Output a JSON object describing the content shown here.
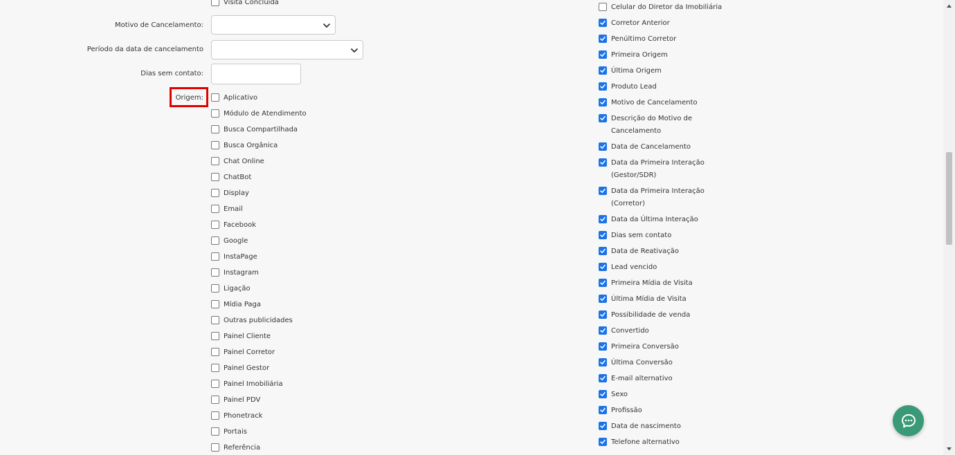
{
  "filters": {
    "top_partial_item": "Visita Concluída",
    "cancel_reason_label": "Motivo de Cancelamento:",
    "cancel_period_label": "Período da data de cancelamento",
    "days_no_contact_label": "Dias sem contato:",
    "origin_label": "Origem:",
    "origin_options": [
      "Aplicativo",
      "Módulo de Atendimento",
      "Busca Compartilhada",
      "Busca Orgânica",
      "Chat Online",
      "ChatBot",
      "Display",
      "Email",
      "Facebook",
      "Google",
      "InstaPage",
      "Instagram",
      "Ligação",
      "Mídia Paga",
      "Outras publicidades",
      "Painel Cliente",
      "Painel Corretor",
      "Painel Gestor",
      "Painel Imobiliária",
      "Painel PDV",
      "Phonetrack",
      "Portais",
      "Referência"
    ]
  },
  "columns": {
    "items": [
      {
        "label": "Celular do Diretor da Imobiliária",
        "checked": false
      },
      {
        "label": "Corretor Anterior",
        "checked": true
      },
      {
        "label": "Penúltimo Corretor",
        "checked": true
      },
      {
        "label": "Primeira Origem",
        "checked": true
      },
      {
        "label": "Última Origem",
        "checked": true
      },
      {
        "label": "Produto Lead",
        "checked": true
      },
      {
        "label": "Motivo de Cancelamento",
        "checked": true
      },
      {
        "label": "Descrição do Motivo de Cancelamento",
        "checked": true
      },
      {
        "label": "Data de Cancelamento",
        "checked": true
      },
      {
        "label": "Data da Primeira Interação (Gestor/SDR)",
        "checked": true
      },
      {
        "label": "Data da Primeira Interação (Corretor)",
        "checked": true
      },
      {
        "label": "Data da Última Interação",
        "checked": true
      },
      {
        "label": "Dias sem contato",
        "checked": true
      },
      {
        "label": "Data de Reativação",
        "checked": true
      },
      {
        "label": "Lead vencido",
        "checked": true
      },
      {
        "label": "Primeira Mídia de Visita",
        "checked": true
      },
      {
        "label": "Última Mídia de Visita",
        "checked": true
      },
      {
        "label": "Possibilidade de venda",
        "checked": true
      },
      {
        "label": "Convertido",
        "checked": true
      },
      {
        "label": "Primeira Conversão",
        "checked": true
      },
      {
        "label": "Última Conversão",
        "checked": true
      },
      {
        "label": "E-mail alternativo",
        "checked": true
      },
      {
        "label": "Sexo",
        "checked": true
      },
      {
        "label": "Profissão",
        "checked": true
      },
      {
        "label": "Data de nascimento",
        "checked": true
      },
      {
        "label": "Telefone alternativo",
        "checked": true
      }
    ]
  },
  "colors": {
    "checkbox_checked": "#1a73e8",
    "highlight": "#e00000",
    "chat_button": "#3a9a78"
  },
  "icons": {
    "chat": "chat-bubble-icon",
    "dropdown": "chevron-down-icon"
  }
}
